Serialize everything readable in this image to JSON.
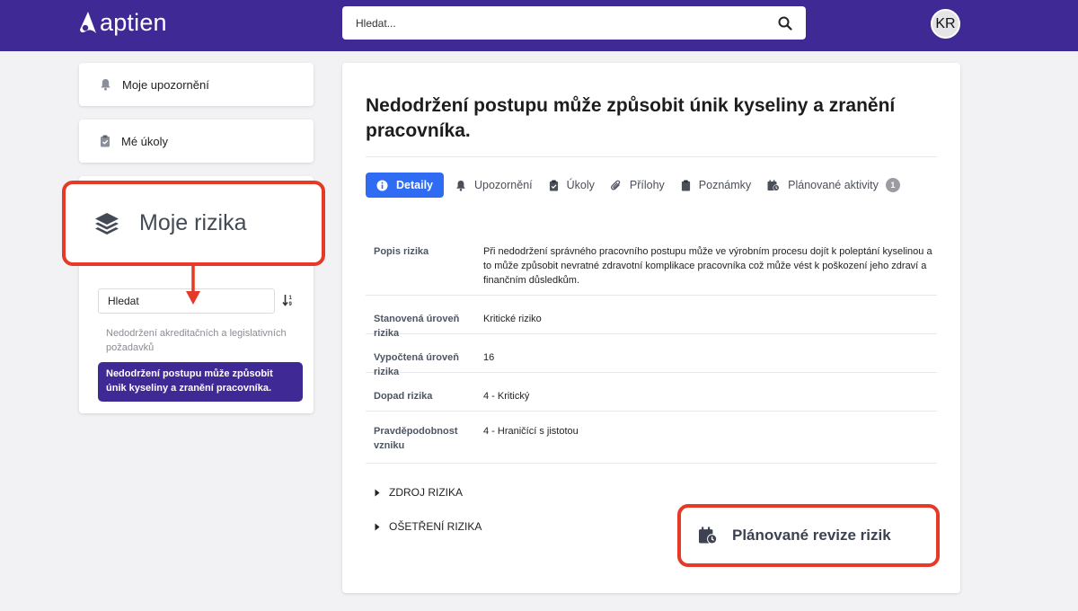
{
  "app": {
    "logo_text": "aptien"
  },
  "header": {
    "search_placeholder": "Hledat...",
    "search_icon": "search-icon",
    "avatar_initials": "KR"
  },
  "sidebar": {
    "items": [
      {
        "label": "Moje upozornění",
        "icon": "bell-icon"
      },
      {
        "label": "Mé úkoly",
        "icon": "clipboard-icon"
      }
    ],
    "risks_callout": {
      "label": "Moje rizika",
      "icon": "layers-icon"
    },
    "risk_search_value": "Hledat",
    "risk_list": [
      {
        "label": "Nedodržení akreditačních a legislativních požadavků",
        "active": false
      },
      {
        "label": "Nedodržení postupu může způsobit únik kyseliny a zranění pracovníka.",
        "active": true
      }
    ]
  },
  "main": {
    "title": "Nedodržení postupu může způsobit únik kyseliny a zranění pracovníka.",
    "tabs": [
      {
        "label": "Detaily",
        "icon": "info-icon",
        "active": true
      },
      {
        "label": "Upozornění",
        "icon": "bell-icon",
        "active": false
      },
      {
        "label": "Úkoly",
        "icon": "clipboard-check-icon",
        "active": false
      },
      {
        "label": "Přílohy",
        "icon": "paperclip-icon",
        "active": false
      },
      {
        "label": "Poznámky",
        "icon": "clipboard-icon",
        "active": false
      },
      {
        "label": "Plánované aktivity",
        "icon": "calendar-clock-icon",
        "active": false,
        "count": "1"
      }
    ],
    "details": [
      {
        "label": "Popis rizika",
        "value": "Při nedodržení správného pracovního postupu může ve výrobním procesu dojít k poleptání kyselinou a to může způsobit nevratné zdravotní komplikace pracovníka což může vést k poškození jeho zdraví a finančním důsledkům."
      },
      {
        "label": "Stanovená úroveň rizika",
        "value": "Kritické riziko"
      },
      {
        "label": "Vypočtená úroveň rizika",
        "value": "16"
      },
      {
        "label": "Dopad rizika",
        "value": "4 - Kritický"
      },
      {
        "label": "Pravděpodobnost vzniku",
        "value": "4 - Hraničící s jistotou"
      }
    ],
    "sections": [
      {
        "label": "ZDROJ RIZIKA"
      },
      {
        "label": "OŠETŘENÍ RIZIKA"
      }
    ],
    "revisions_callout": {
      "label": "Plánované revize rizik",
      "icon": "calendar-clock-icon"
    }
  },
  "colors": {
    "brand": "#3f2a95",
    "accent": "#2f6cf3",
    "callout_border": "#e53a27"
  }
}
